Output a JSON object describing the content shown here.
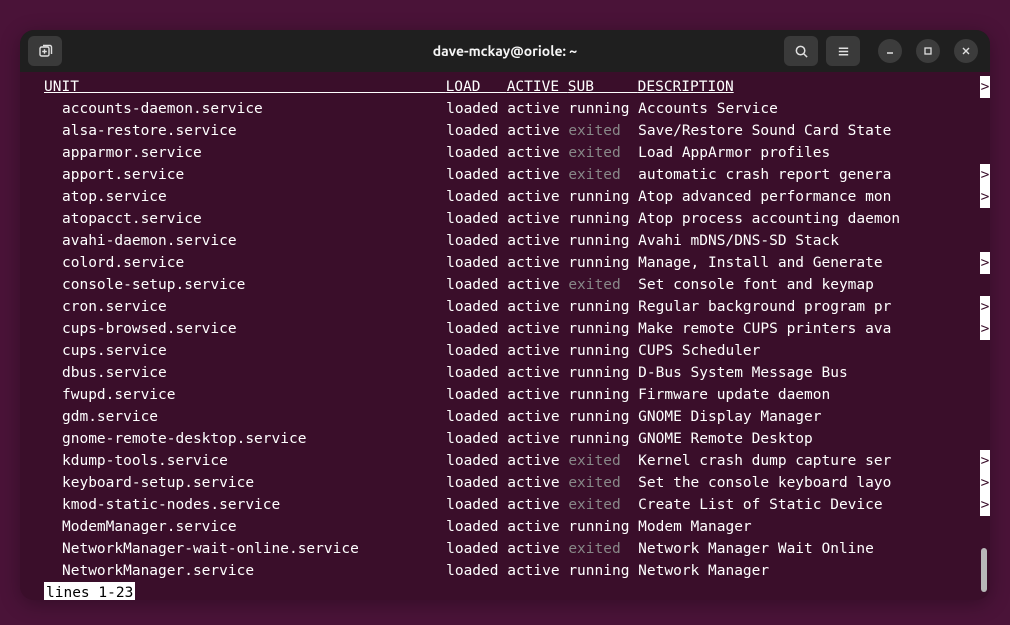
{
  "window": {
    "title": "dave-mckay@oriole: ~"
  },
  "header": {
    "unit": "UNIT",
    "load": "LOAD",
    "active": "ACTIVE",
    "sub": "SUB",
    "description": "DESCRIPTION"
  },
  "services": [
    {
      "unit": "accounts-daemon.service",
      "load": "loaded",
      "active": "active",
      "sub": "running",
      "desc": "Accounts Service",
      "overflow": false
    },
    {
      "unit": "alsa-restore.service",
      "load": "loaded",
      "active": "active",
      "sub": "exited",
      "desc": "Save/Restore Sound Card State",
      "overflow": false
    },
    {
      "unit": "apparmor.service",
      "load": "loaded",
      "active": "active",
      "sub": "exited",
      "desc": "Load AppArmor profiles",
      "overflow": false
    },
    {
      "unit": "apport.service",
      "load": "loaded",
      "active": "active",
      "sub": "exited",
      "desc": "automatic crash report genera",
      "overflow": true
    },
    {
      "unit": "atop.service",
      "load": "loaded",
      "active": "active",
      "sub": "running",
      "desc": "Atop advanced performance mon",
      "overflow": true
    },
    {
      "unit": "atopacct.service",
      "load": "loaded",
      "active": "active",
      "sub": "running",
      "desc": "Atop process accounting daemon",
      "overflow": false
    },
    {
      "unit": "avahi-daemon.service",
      "load": "loaded",
      "active": "active",
      "sub": "running",
      "desc": "Avahi mDNS/DNS-SD Stack",
      "overflow": false
    },
    {
      "unit": "colord.service",
      "load": "loaded",
      "active": "active",
      "sub": "running",
      "desc": "Manage, Install and Generate ",
      "overflow": true
    },
    {
      "unit": "console-setup.service",
      "load": "loaded",
      "active": "active",
      "sub": "exited",
      "desc": "Set console font and keymap",
      "overflow": false
    },
    {
      "unit": "cron.service",
      "load": "loaded",
      "active": "active",
      "sub": "running",
      "desc": "Regular background program pr",
      "overflow": true
    },
    {
      "unit": "cups-browsed.service",
      "load": "loaded",
      "active": "active",
      "sub": "running",
      "desc": "Make remote CUPS printers ava",
      "overflow": true
    },
    {
      "unit": "cups.service",
      "load": "loaded",
      "active": "active",
      "sub": "running",
      "desc": "CUPS Scheduler",
      "overflow": false
    },
    {
      "unit": "dbus.service",
      "load": "loaded",
      "active": "active",
      "sub": "running",
      "desc": "D-Bus System Message Bus",
      "overflow": false
    },
    {
      "unit": "fwupd.service",
      "load": "loaded",
      "active": "active",
      "sub": "running",
      "desc": "Firmware update daemon",
      "overflow": false
    },
    {
      "unit": "gdm.service",
      "load": "loaded",
      "active": "active",
      "sub": "running",
      "desc": "GNOME Display Manager",
      "overflow": false
    },
    {
      "unit": "gnome-remote-desktop.service",
      "load": "loaded",
      "active": "active",
      "sub": "running",
      "desc": "GNOME Remote Desktop",
      "overflow": false
    },
    {
      "unit": "kdump-tools.service",
      "load": "loaded",
      "active": "active",
      "sub": "exited",
      "desc": "Kernel crash dump capture ser",
      "overflow": true
    },
    {
      "unit": "keyboard-setup.service",
      "load": "loaded",
      "active": "active",
      "sub": "exited",
      "desc": "Set the console keyboard layo",
      "overflow": true
    },
    {
      "unit": "kmod-static-nodes.service",
      "load": "loaded",
      "active": "active",
      "sub": "exited",
      "desc": "Create List of Static Device ",
      "overflow": true
    },
    {
      "unit": "ModemManager.service",
      "load": "loaded",
      "active": "active",
      "sub": "running",
      "desc": "Modem Manager",
      "overflow": false
    },
    {
      "unit": "NetworkManager-wait-online.service",
      "load": "loaded",
      "active": "active",
      "sub": "exited",
      "desc": "Network Manager Wait Online",
      "overflow": false
    },
    {
      "unit": "NetworkManager.service",
      "load": "loaded",
      "active": "active",
      "sub": "running",
      "desc": "Network Manager",
      "overflow": false
    }
  ],
  "pager": {
    "status": "lines 1-23"
  },
  "columns": {
    "unit_width": 46,
    "load_width": 7,
    "active_width": 7,
    "sub_width": 8
  }
}
